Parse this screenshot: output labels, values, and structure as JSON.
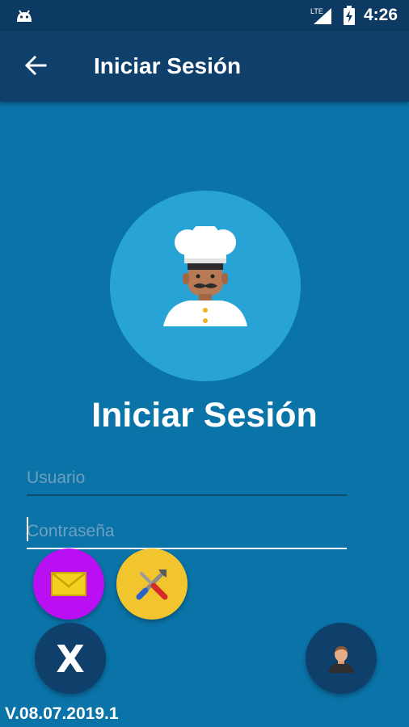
{
  "status_bar": {
    "time": "4:26",
    "network": "LTE"
  },
  "app_bar": {
    "title": "Iniciar Sesión"
  },
  "login": {
    "heading": "Iniciar Sesión",
    "username_placeholder": "Usuario",
    "password_placeholder": "Contraseña"
  },
  "actions": {
    "close_label": "X",
    "icons": [
      "email-icon",
      "tools-icon",
      "user-icon"
    ]
  },
  "version": "V.08.07.2019.1",
  "colors": {
    "background": "#0a73a8",
    "app_bar": "#0f3f6b",
    "avatar_circle": "#27a3d6",
    "email_fab": "#b90ff2",
    "tools_fab": "#f2c52e"
  }
}
